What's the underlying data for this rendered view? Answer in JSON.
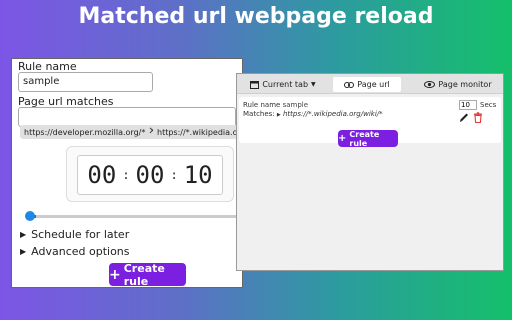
{
  "headline": "Matched url webpage  reload",
  "form": {
    "rule_name_label": "Rule name",
    "rule_name_value": "sample",
    "page_url_label": "Page url matches",
    "chips": [
      "https://developer.mozilla.org/*",
      "https://*.wikipedia.org"
    ],
    "timer": {
      "hours": "00",
      "minutes": "00",
      "seconds": "10",
      "separator": ":"
    },
    "slider_value_fraction": 0.03,
    "schedule_label": "Schedule for later",
    "advanced_label": "Advanced options",
    "create_button": "Create rule"
  },
  "popup": {
    "tabs": [
      {
        "label": "Current tab",
        "icon": "window-icon"
      },
      {
        "label": "Page url",
        "icon": "link-icon"
      },
      {
        "label": "Page monitor",
        "icon": "eye-icon"
      }
    ],
    "active_tab": "Page url",
    "rule": {
      "name_label": "Rule name",
      "name_value": "sample",
      "matches_label": "Matches:",
      "matches_value": "https://*.wikipedia.org/wiki/*",
      "secs_value": "10",
      "secs_label": "Secs"
    },
    "create_button": "Create rule"
  },
  "colors": {
    "accent": "#7b1fe0",
    "delete": "#e53935",
    "slider_thumb": "#1e88e5"
  }
}
